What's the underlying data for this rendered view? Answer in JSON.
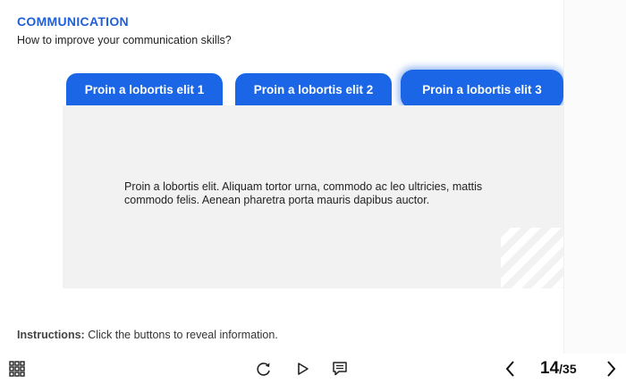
{
  "slide": {
    "title": "COMMUNICATION",
    "subtitle": "How to improve your communication skills?",
    "tabs": [
      {
        "label": "Proin a lobortis elit 1"
      },
      {
        "label": "Proin a lobortis elit 2"
      },
      {
        "label": "Proin a lobortis elit 3",
        "active": true
      }
    ],
    "content_text": "Proin a lobortis elit. Aliquam tortor urna, commodo ac leo ultricies, mattis commodo felis. Aenean pharetra porta mauris dapibus auctor.",
    "instructions_label": "Instructions:",
    "instructions_text": "Click the buttons to reveal information."
  },
  "player": {
    "icons": {
      "menu": "grid-menu-icon",
      "replay": "replay-icon",
      "play": "play-icon",
      "notes": "notes-icon",
      "prev": "chevron-left-icon",
      "next": "chevron-right-icon"
    },
    "current_page": "14",
    "total_pages": "/35"
  },
  "colors": {
    "accent": "#1a66e6",
    "title": "#1f5fd8",
    "content_bg": "#f2f2f2"
  }
}
